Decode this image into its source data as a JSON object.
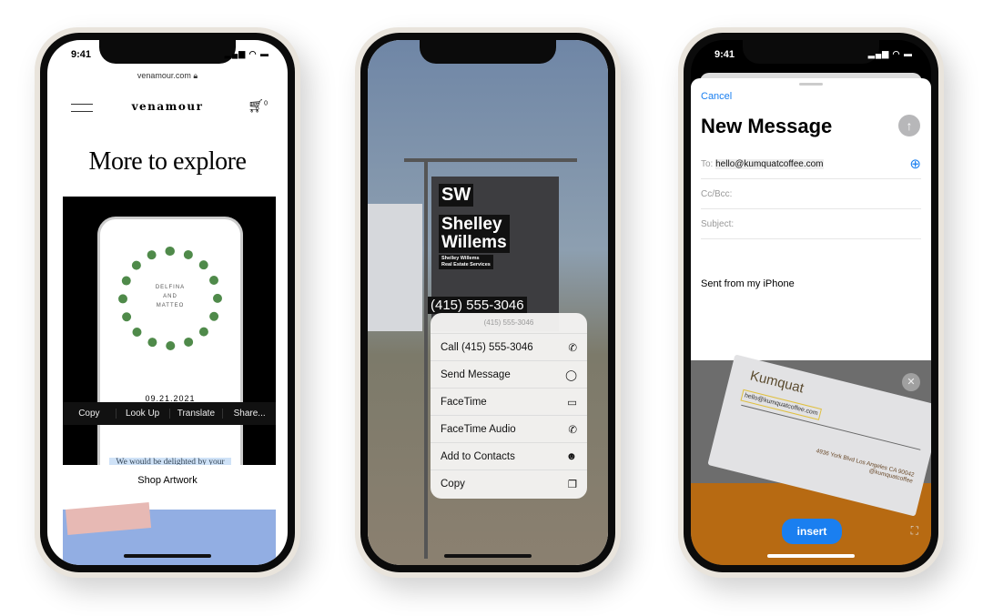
{
  "phones": [
    {
      "time": "9:41",
      "url": "venamour.com",
      "brand": "venamour",
      "cart_count": "0",
      "title": "More to explore",
      "artwork": {
        "names": [
          "DELFINA",
          "AND",
          "MATTEO"
        ],
        "date": "09.21.2021"
      },
      "text_menu": [
        "Copy",
        "Look Up",
        "Translate",
        "Share..."
      ],
      "selected_text": "We would be delighted by your presence at our intimate wedding celebration. We treasure",
      "shop_label": "Shop Artwork"
    },
    {
      "sign": {
        "initials": "SW",
        "name_line1": "Shelley",
        "name_line2": "Willems",
        "sub1": "Shelley Willems",
        "sub2": "Real Estate Services",
        "phone": "(415) 555-3046"
      },
      "menu_header": "(415) 555-3046",
      "menu_items": [
        {
          "label": "Call (415) 555-3046",
          "icon": "phone-icon",
          "glyph": "✆"
        },
        {
          "label": "Send Message",
          "icon": "message-bubble-icon",
          "glyph": "◯"
        },
        {
          "label": "FaceTime",
          "icon": "video-camera-icon",
          "glyph": "▭"
        },
        {
          "label": "FaceTime Audio",
          "icon": "phone-icon",
          "glyph": "✆"
        },
        {
          "label": "Add to Contacts",
          "icon": "add-contact-icon",
          "glyph": "☻"
        },
        {
          "label": "Copy",
          "icon": "copy-icon",
          "glyph": "❐"
        }
      ]
    },
    {
      "time": "9:41",
      "cancel": "Cancel",
      "title": "New Message",
      "to_label": "To:",
      "to_value": "hello@kumquatcoffee.com",
      "cc_label": "Cc/Bcc:",
      "subject_label": "Subject:",
      "signature": "Sent from my iPhone",
      "card": {
        "brand": "Kumquat",
        "email": "hello@kumquatcoffee.com",
        "address": "4936 York Blvd Los Angeles CA 90042",
        "handle": "@kumquatcoffee"
      },
      "insert_label": "insert",
      "accent": "#1a7ff0"
    }
  ]
}
